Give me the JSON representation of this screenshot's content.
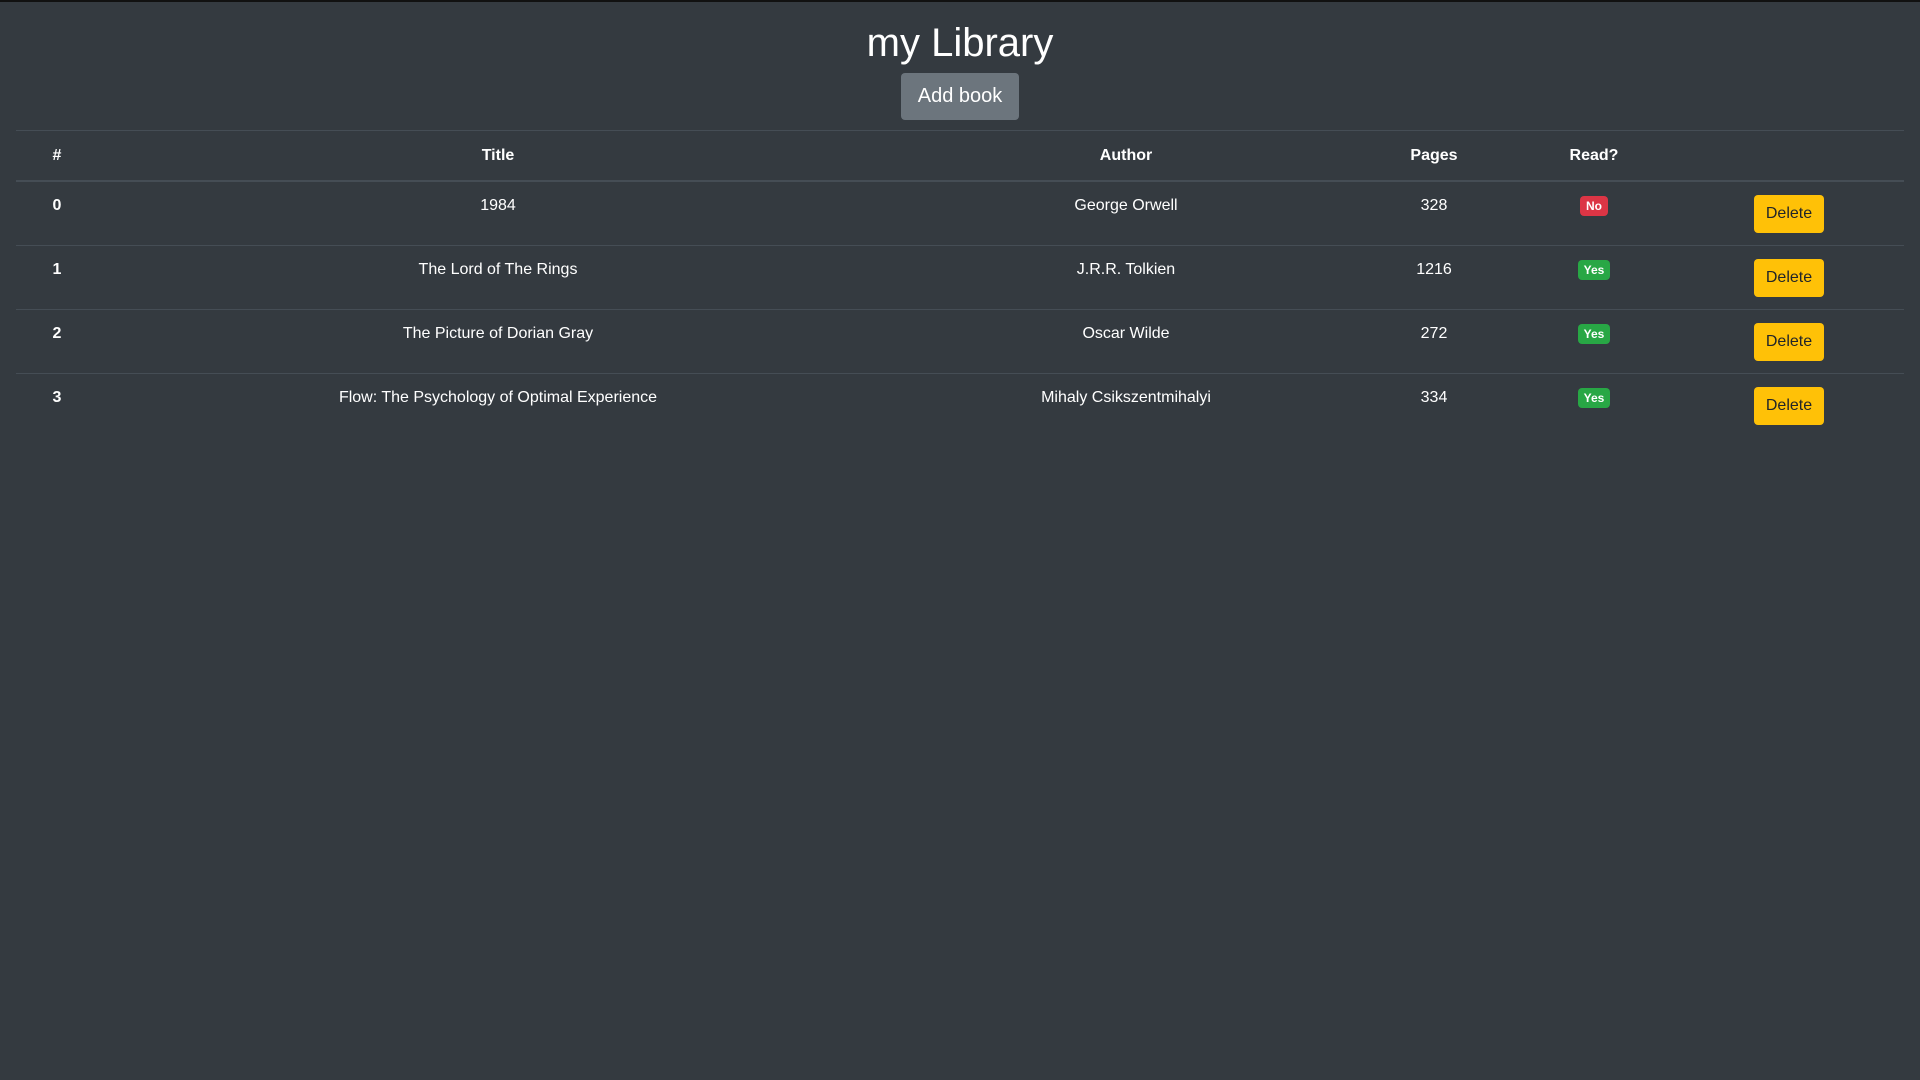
{
  "header": {
    "title": "my Library",
    "add_label": "Add book"
  },
  "table": {
    "columns": [
      "#",
      "Title",
      "Author",
      "Pages",
      "Read?",
      ""
    ],
    "rows": [
      {
        "index": "0",
        "title": "1984",
        "author": "George Orwell",
        "pages": "328",
        "read": "No",
        "read_color": "#dc3545",
        "action": "Delete"
      },
      {
        "index": "1",
        "title": "The Lord of The Rings",
        "author": "J.R.R. Tolkien",
        "pages": "1216",
        "read": "Yes",
        "read_color": "#28a745",
        "action": "Delete"
      },
      {
        "index": "2",
        "title": "The Picture of Dorian Gray",
        "author": "Oscar Wilde",
        "pages": "272",
        "read": "Yes",
        "read_color": "#28a745",
        "action": "Delete"
      },
      {
        "index": "3",
        "title": "Flow: The Psychology of Optimal Experience",
        "author": "Mihaly Csikszentmihalyi",
        "pages": "334",
        "read": "Yes",
        "read_color": "#28a745",
        "action": "Delete"
      }
    ]
  },
  "colors": {
    "background": "#343a40",
    "button": "#6c757d",
    "delete": "#ffc107"
  }
}
